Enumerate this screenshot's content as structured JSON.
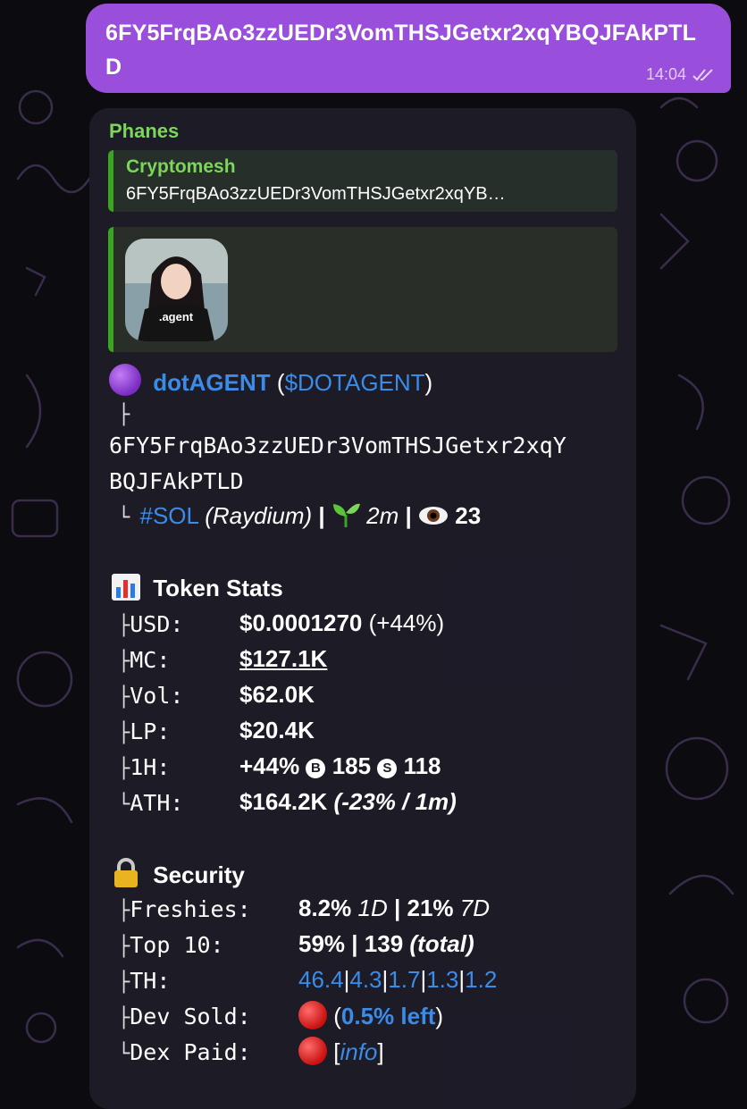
{
  "outgoing": {
    "text": "6FY5FrqBAo3zzUEDr3VomTHSJGetxr2xqYBQJFAkPTLD",
    "time": "14:04"
  },
  "incoming": {
    "sender": "Phanes",
    "reply": {
      "name": "Cryptomesh",
      "text": "6FY5FrqBAo3zzUEDr3VomTHSJGetxr2xqYB…"
    },
    "avatar_shirt_text": ".agent",
    "token": {
      "name": "dotAGENT",
      "open_paren": "(",
      "ticker": "$DOTAGENT",
      "close_paren": ")",
      "tree_branch": "├",
      "address_line1": "6FY5FrqBAo3zzUEDr3VomTHSJGetxr2xqY",
      "address_line2": "BQJFAkPTLD",
      "tree_end": "└",
      "chain": "#SOL",
      "dex": "(Raydium)",
      "sep": "|",
      "age": "2m",
      "views": "23"
    },
    "stats": {
      "title": "Token Stats",
      "rows": [
        {
          "tree": "├",
          "label": "USD:",
          "value": "$0.0001270",
          "extra": "(+44%)"
        },
        {
          "tree": "├",
          "label": "MC:",
          "value": "$127.1K"
        },
        {
          "tree": "├",
          "label": "Vol:",
          "value": "$62.0K"
        },
        {
          "tree": "├",
          "label": "LP:",
          "value": "$20.4K"
        },
        {
          "tree": "├",
          "label": "1H:",
          "value": "+44%",
          "b_icon": "B",
          "buys": "185",
          "s_icon": "S",
          "sells": "118"
        },
        {
          "tree": "└",
          "label": "ATH:",
          "value": "$164.2K",
          "extra": "(-23% / 1m)"
        }
      ]
    },
    "security": {
      "title": "Security",
      "freshies": {
        "tree": "├",
        "label": "Freshies:",
        "v1": "8.2%",
        "p1": "1D",
        "sep": "|",
        "v2": "21%",
        "p2": "7D"
      },
      "top10": {
        "tree": "├",
        "label": "Top 10:",
        "pct": "59%",
        "sep": "|",
        "count": "139",
        "note": "(total)"
      },
      "th": {
        "tree": "├",
        "label": "TH:",
        "values": [
          "46.4",
          "4.3",
          "1.7",
          "1.3",
          "1.2"
        ],
        "sep": "|"
      },
      "dev_sold": {
        "tree": "├",
        "label": "Dev Sold:",
        "open": "(",
        "link": "0.5% left",
        "close": ")"
      },
      "dex_paid": {
        "tree": "└",
        "label": "Dex Paid:",
        "open": "[",
        "link": "info",
        "close": "]"
      }
    }
  },
  "colors": {
    "outgoing_bubble": "#9a4fdc",
    "incoming_bubble": "#1e1c28",
    "sender_green": "#7cd65a",
    "link_blue": "#3a8ce8",
    "red_status": "#e02020"
  },
  "icons": [
    "purple-circle-emoji",
    "seedling-icon",
    "eye-icon",
    "bar-chart-icon",
    "lock-icon",
    "red-circle-icon",
    "double-check-icon"
  ]
}
